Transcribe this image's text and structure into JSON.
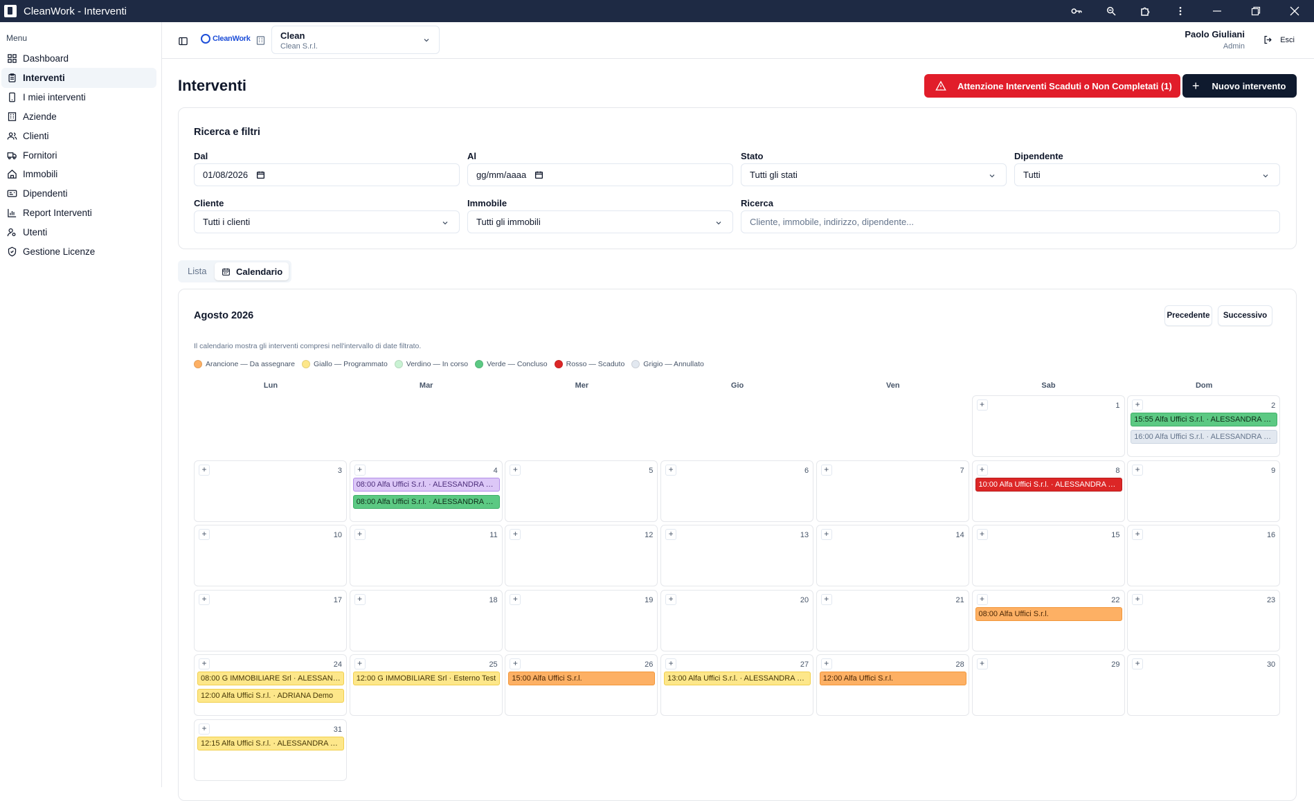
{
  "window": {
    "title": "CleanWork - Interventi"
  },
  "sidebar": {
    "menu_label": "Menu",
    "items": [
      {
        "label": "Dashboard",
        "icon": "dashboard-icon"
      },
      {
        "label": "Interventi",
        "icon": "clipboard-icon",
        "active": true
      },
      {
        "label": "I miei interventi",
        "icon": "phone-icon"
      },
      {
        "label": "Aziende",
        "icon": "building-icon"
      },
      {
        "label": "Clienti",
        "icon": "users-icon"
      },
      {
        "label": "Fornitori",
        "icon": "truck-icon"
      },
      {
        "label": "Immobili",
        "icon": "home-icon"
      },
      {
        "label": "Dipendenti",
        "icon": "id-card-icon"
      },
      {
        "label": "Report Interventi",
        "icon": "bar-chart-icon"
      },
      {
        "label": "Utenti",
        "icon": "user-key-icon"
      },
      {
        "label": "Gestione Licenze",
        "icon": "shield-icon"
      }
    ]
  },
  "topbar": {
    "logo_text": "CleanWork",
    "company": {
      "name": "Clean",
      "sub": "Clean S.r.l."
    },
    "user": {
      "name": "Paolo Giuliani",
      "role": "Admin"
    },
    "logout_label": "Esci"
  },
  "page": {
    "title": "Interventi",
    "alert_label": "Attenzione Interventi Scaduti o Non Completati (1)",
    "new_label": "Nuovo intervento"
  },
  "filters": {
    "title": "Ricerca e filtri",
    "dal": {
      "label": "Dal",
      "value": "01/08/2026"
    },
    "al": {
      "label": "Al",
      "placeholder": "gg/mm/aaaa"
    },
    "stato": {
      "label": "Stato",
      "value": "Tutti gli stati"
    },
    "dipendente": {
      "label": "Dipendente",
      "value": "Tutti"
    },
    "cliente": {
      "label": "Cliente",
      "value": "Tutti i clienti"
    },
    "immobile": {
      "label": "Immobile",
      "value": "Tutti gli immobili"
    },
    "ricerca": {
      "label": "Ricerca",
      "placeholder": "Cliente, immobile, indirizzo, dipendente..."
    }
  },
  "view_toggle": {
    "lista": "Lista",
    "calendario": "Calendario"
  },
  "calendar": {
    "month": "Agosto 2026",
    "prev_label": "Precedente",
    "next_label": "Successivo",
    "note": "Il calendario mostra gli interventi compresi nell'intervallo di date filtrato.",
    "legend": [
      {
        "label": "Arancione — Da assegnare",
        "color": "#fdb064"
      },
      {
        "label": "Giallo — Programmato",
        "color": "#fde78a"
      },
      {
        "label": "Verdino — In corso",
        "color": "#c9f2d3"
      },
      {
        "label": "Verde — Concluso",
        "color": "#5cc983"
      },
      {
        "label": "Rosso — Scaduto",
        "color": "#dc2626"
      },
      {
        "label": "Grigio — Annullato",
        "color": "#e2e8f0"
      }
    ],
    "weekdays": [
      "Lun",
      "Mar",
      "Mer",
      "Gio",
      "Ven",
      "Sab",
      "Dom"
    ],
    "first_weekday_index": 5,
    "days_in_month": 31,
    "events": {
      "2": [
        {
          "text": "15:55 Alfa Uffici S.r.l. · ALESSANDRA Pr...",
          "status": "verde"
        },
        {
          "text": "16:00 Alfa Uffici S.r.l. · ALESSANDRA Pr...",
          "status": "grigio"
        }
      ],
      "4": [
        {
          "text": "08:00 Alfa Uffici S.r.l. · ALESSANDRA Pr...",
          "status": "viola"
        },
        {
          "text": "08:00 Alfa Uffici S.r.l. · ALESSANDRA Pr...",
          "status": "verde"
        }
      ],
      "8": [
        {
          "text": "10:00 Alfa Uffici S.r.l. · ALESSANDRA Pr...",
          "status": "rosso"
        }
      ],
      "22": [
        {
          "text": "08:00 Alfa Uffici S.r.l.",
          "status": "arancio"
        }
      ],
      "24": [
        {
          "text": "08:00 G IMMOBILIARE Srl · ALESSAND...",
          "status": "giallo"
        },
        {
          "text": "12:00 Alfa Uffici S.r.l. · ADRIANA Demo",
          "status": "giallo"
        }
      ],
      "25": [
        {
          "text": "12:00 G IMMOBILIARE Srl · Esterno Test",
          "status": "giallo"
        }
      ],
      "26": [
        {
          "text": "15:00 Alfa Uffici S.r.l.",
          "status": "arancio"
        }
      ],
      "27": [
        {
          "text": "13:00 Alfa Uffici S.r.l. · ALESSANDRA Pr...",
          "status": "giallo"
        }
      ],
      "28": [
        {
          "text": "12:00 Alfa Uffici S.r.l.",
          "status": "arancio"
        }
      ],
      "31": [
        {
          "text": "12:15 Alfa Uffici S.r.l. · ALESSANDRA Pr...",
          "status": "giallo"
        }
      ]
    }
  }
}
